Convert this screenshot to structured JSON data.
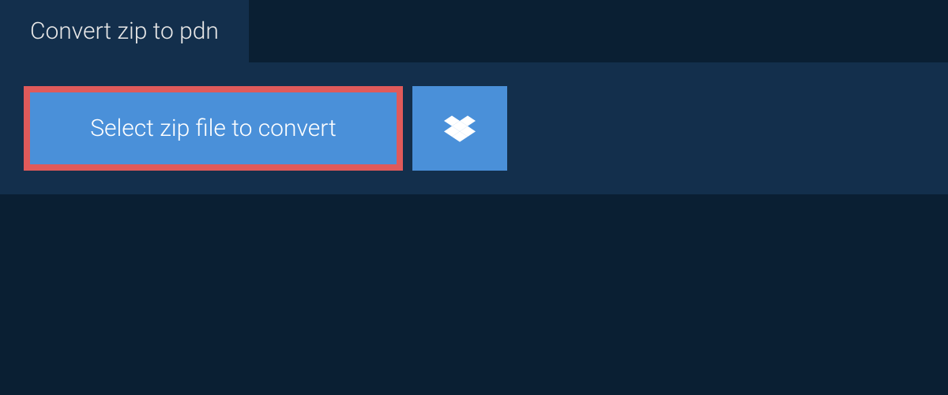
{
  "tab": {
    "title": "Convert zip to pdn"
  },
  "upload": {
    "select_button_label": "Select zip file to convert"
  },
  "icons": {
    "dropbox": "dropbox-icon"
  },
  "colors": {
    "background": "#0a1f33",
    "panel": "#132f4c",
    "button": "#4a90d9",
    "highlight_border": "#e05a5a",
    "text_light": "#ffffff"
  }
}
